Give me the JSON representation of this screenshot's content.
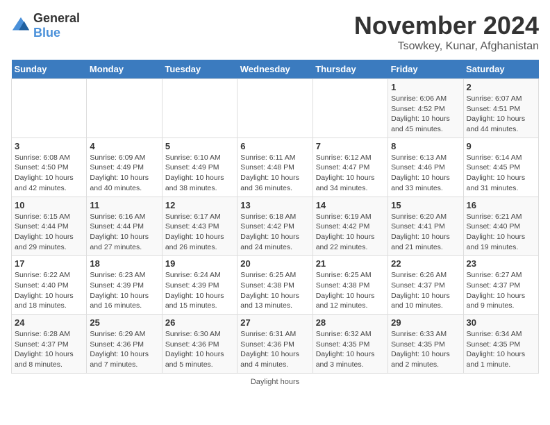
{
  "header": {
    "logo_general": "General",
    "logo_blue": "Blue",
    "month_title": "November 2024",
    "location": "Tsowkey, Kunar, Afghanistan"
  },
  "days_of_week": [
    "Sunday",
    "Monday",
    "Tuesday",
    "Wednesday",
    "Thursday",
    "Friday",
    "Saturday"
  ],
  "weeks": [
    [
      {
        "day": "",
        "info": ""
      },
      {
        "day": "",
        "info": ""
      },
      {
        "day": "",
        "info": ""
      },
      {
        "day": "",
        "info": ""
      },
      {
        "day": "",
        "info": ""
      },
      {
        "day": "1",
        "info": "Sunrise: 6:06 AM\nSunset: 4:52 PM\nDaylight: 10 hours and 45 minutes."
      },
      {
        "day": "2",
        "info": "Sunrise: 6:07 AM\nSunset: 4:51 PM\nDaylight: 10 hours and 44 minutes."
      }
    ],
    [
      {
        "day": "3",
        "info": "Sunrise: 6:08 AM\nSunset: 4:50 PM\nDaylight: 10 hours and 42 minutes."
      },
      {
        "day": "4",
        "info": "Sunrise: 6:09 AM\nSunset: 4:49 PM\nDaylight: 10 hours and 40 minutes."
      },
      {
        "day": "5",
        "info": "Sunrise: 6:10 AM\nSunset: 4:49 PM\nDaylight: 10 hours and 38 minutes."
      },
      {
        "day": "6",
        "info": "Sunrise: 6:11 AM\nSunset: 4:48 PM\nDaylight: 10 hours and 36 minutes."
      },
      {
        "day": "7",
        "info": "Sunrise: 6:12 AM\nSunset: 4:47 PM\nDaylight: 10 hours and 34 minutes."
      },
      {
        "day": "8",
        "info": "Sunrise: 6:13 AM\nSunset: 4:46 PM\nDaylight: 10 hours and 33 minutes."
      },
      {
        "day": "9",
        "info": "Sunrise: 6:14 AM\nSunset: 4:45 PM\nDaylight: 10 hours and 31 minutes."
      }
    ],
    [
      {
        "day": "10",
        "info": "Sunrise: 6:15 AM\nSunset: 4:44 PM\nDaylight: 10 hours and 29 minutes."
      },
      {
        "day": "11",
        "info": "Sunrise: 6:16 AM\nSunset: 4:44 PM\nDaylight: 10 hours and 27 minutes."
      },
      {
        "day": "12",
        "info": "Sunrise: 6:17 AM\nSunset: 4:43 PM\nDaylight: 10 hours and 26 minutes."
      },
      {
        "day": "13",
        "info": "Sunrise: 6:18 AM\nSunset: 4:42 PM\nDaylight: 10 hours and 24 minutes."
      },
      {
        "day": "14",
        "info": "Sunrise: 6:19 AM\nSunset: 4:42 PM\nDaylight: 10 hours and 22 minutes."
      },
      {
        "day": "15",
        "info": "Sunrise: 6:20 AM\nSunset: 4:41 PM\nDaylight: 10 hours and 21 minutes."
      },
      {
        "day": "16",
        "info": "Sunrise: 6:21 AM\nSunset: 4:40 PM\nDaylight: 10 hours and 19 minutes."
      }
    ],
    [
      {
        "day": "17",
        "info": "Sunrise: 6:22 AM\nSunset: 4:40 PM\nDaylight: 10 hours and 18 minutes."
      },
      {
        "day": "18",
        "info": "Sunrise: 6:23 AM\nSunset: 4:39 PM\nDaylight: 10 hours and 16 minutes."
      },
      {
        "day": "19",
        "info": "Sunrise: 6:24 AM\nSunset: 4:39 PM\nDaylight: 10 hours and 15 minutes."
      },
      {
        "day": "20",
        "info": "Sunrise: 6:25 AM\nSunset: 4:38 PM\nDaylight: 10 hours and 13 minutes."
      },
      {
        "day": "21",
        "info": "Sunrise: 6:25 AM\nSunset: 4:38 PM\nDaylight: 10 hours and 12 minutes."
      },
      {
        "day": "22",
        "info": "Sunrise: 6:26 AM\nSunset: 4:37 PM\nDaylight: 10 hours and 10 minutes."
      },
      {
        "day": "23",
        "info": "Sunrise: 6:27 AM\nSunset: 4:37 PM\nDaylight: 10 hours and 9 minutes."
      }
    ],
    [
      {
        "day": "24",
        "info": "Sunrise: 6:28 AM\nSunset: 4:37 PM\nDaylight: 10 hours and 8 minutes."
      },
      {
        "day": "25",
        "info": "Sunrise: 6:29 AM\nSunset: 4:36 PM\nDaylight: 10 hours and 7 minutes."
      },
      {
        "day": "26",
        "info": "Sunrise: 6:30 AM\nSunset: 4:36 PM\nDaylight: 10 hours and 5 minutes."
      },
      {
        "day": "27",
        "info": "Sunrise: 6:31 AM\nSunset: 4:36 PM\nDaylight: 10 hours and 4 minutes."
      },
      {
        "day": "28",
        "info": "Sunrise: 6:32 AM\nSunset: 4:35 PM\nDaylight: 10 hours and 3 minutes."
      },
      {
        "day": "29",
        "info": "Sunrise: 6:33 AM\nSunset: 4:35 PM\nDaylight: 10 hours and 2 minutes."
      },
      {
        "day": "30",
        "info": "Sunrise: 6:34 AM\nSunset: 4:35 PM\nDaylight: 10 hours and 1 minute."
      }
    ]
  ],
  "footer": {
    "note": "Daylight hours"
  }
}
